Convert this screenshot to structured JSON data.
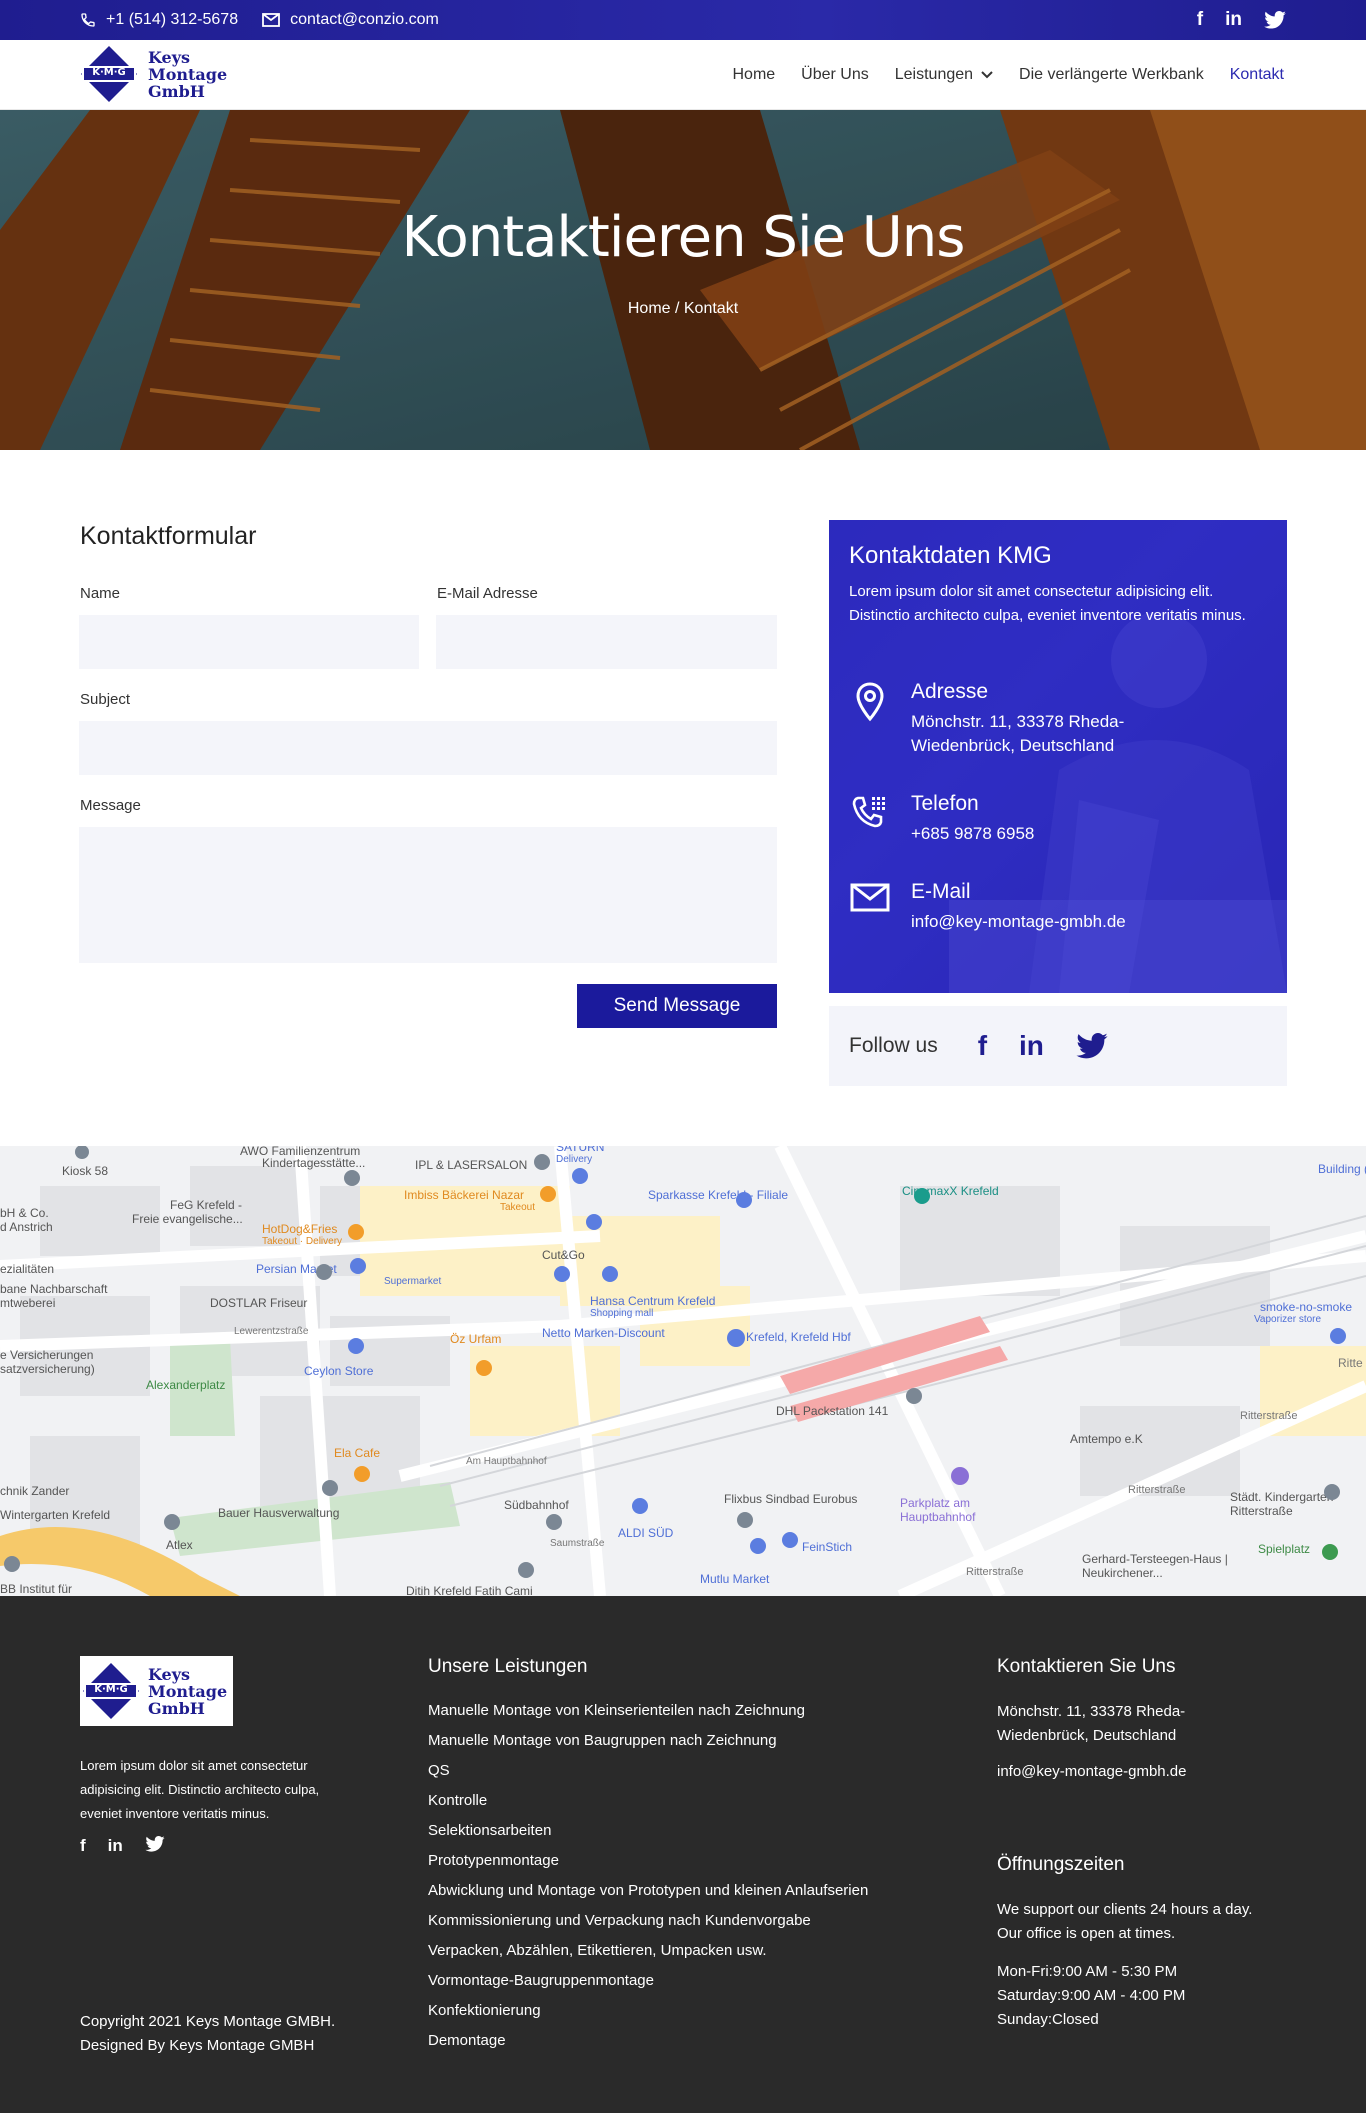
{
  "topbar": {
    "phone": "+1 (514) 312-5678",
    "email": "contact@conzio.com",
    "social": [
      "f",
      "in",
      "twitter"
    ]
  },
  "logo": {
    "badge": "K·M·G",
    "line1": "Keys",
    "line2": "Montage",
    "line3": "GmbH"
  },
  "nav": {
    "items": [
      "Home",
      "Über Uns",
      "Leistungen",
      "Die verlängerte Werkbank",
      "Kontakt"
    ],
    "active": "Kontakt"
  },
  "hero": {
    "title": "Kontaktieren Sie Uns",
    "breadcrumb": "Home / Kontakt"
  },
  "form": {
    "title": "Kontaktformular",
    "name_label": "Name",
    "email_label": "E-Mail Adresse",
    "subject_label": "Subject",
    "message_label": "Message",
    "submit_label": "Send Message"
  },
  "contact_card": {
    "title": "Kontaktdaten KMG",
    "intro": "Lorem ipsum dolor sit amet consectetur adipisicing elit. Distinctio architecto culpa, eveniet inventore veritatis minus.",
    "address_heading": "Adresse",
    "address_line1": "Mönchstr. 11, 33378 Rheda-",
    "address_line2": "Wiedenbrück, Deutschland",
    "phone_heading": "Telefon",
    "phone": "+685 9878 6958",
    "email_heading": "E-Mail",
    "email": "info@key-montage-gmbh.de"
  },
  "follow": {
    "label": "Follow us"
  },
  "map": {
    "labels": [
      "Kiosk 58",
      "AWO Familienzentrum",
      "Kindertagesstätte...",
      "IPL & LASERSALON",
      "SATURN",
      "Delivery",
      "Building (Da",
      "CinemaxX Krefeld",
      "Imbiss Bäckerei Nazar",
      "Takeout",
      "Sparkasse Krefeld - Filiale",
      "FeG Krefeld -",
      "Freie evangelische...",
      "bH & Co.",
      "d Anstrich",
      "HotDog&Fries",
      "Takeout · Delivery",
      "ezialitäten",
      "Persian Market",
      "Cut&Go",
      "bane Nachbarschaft",
      "mtweberei",
      "DOSTLAR Friseur",
      "Supermarket",
      "Hansa Centrum Krefeld",
      "Shopping mall",
      "smoke-no-smoke",
      "Vaporizer store",
      "Lewerentzstraße",
      "Netto Marken-Discount",
      "Krefeld, Krefeld Hbf",
      "Öz Urfam",
      "e Versicherungen",
      "satzversicherung)",
      "Ceylon Store",
      "Rittе",
      "Alexanderplatz",
      "DHL Packstation 141",
      "Ritterstraße",
      "Ela Cafe",
      "Amtempo e.K",
      "Am Hauptbahnhof",
      "Parkplatz am Hauptbahnhof",
      "chnik Zander",
      "Südbahnhof",
      "Flixbus Sindbad Eurobus",
      "Ritterstraße",
      "Städt. Kindergarten Ritterstraße",
      "Wintergarten Krefeld",
      "Bauer Hausverwaltung",
      "ALDI SÜD",
      "Saumstraße",
      "Atlex",
      "FeinStich",
      "Spielplatz",
      "Gerhard-Tersteegen-Haus | Neukirchener...",
      "Ritterstraße",
      "Mutlu Market",
      "BB Institut für",
      "Ditih Krefeld Fatih Cami"
    ]
  },
  "footer": {
    "logo": {
      "badge": "K·M·G",
      "line1": "Keys",
      "line2": "Montage",
      "line3": "GmbH"
    },
    "description": "Lorem ipsum dolor sit amet consectetur adipisicing elit. Distinctio architecto culpa, eveniet inventore veritatis minus.",
    "copyright_line1": "Copyright 2021 Keys Montage GMBH.",
    "copyright_line2": "Designed By Keys Montage GMBH",
    "services_heading": "Unsere Leistungen",
    "services": [
      "Manuelle Montage von Kleinserienteilen nach Zeichnung",
      "Manuelle Montage von Baugruppen nach Zeichnung",
      "QS",
      "Kontrolle",
      "Selektionsarbeiten",
      "Prototypenmontage",
      "Abwicklung und Montage von Prototypen und kleinen Anlaufserien",
      "Kommissionierung und Verpackung nach Kundenvorgabe",
      "Verpacken, Abzählen, Etikettieren, Umpacken usw.",
      "Vormontage-Baugruppenmontage",
      "Konfektionierung",
      "Demontage"
    ],
    "contact_heading": "Kontaktieren Sie Uns",
    "address_line1": "Mönchstr. 11, 33378 Rheda-",
    "address_line2": "Wiedenbrück, Deutschland",
    "email": "info@key-montage-gmbh.de",
    "hours_heading": "Öffnungszeiten",
    "hours_intro1": "We support our clients 24 hours a day.",
    "hours_intro2": "Our office is open at times.",
    "hours_weekday": "Mon-Fri:9:00 AM - 5:30 PM",
    "hours_saturday": "Saturday:9:00 AM - 4:00 PM",
    "hours_sunday": "Sunday:Closed"
  }
}
